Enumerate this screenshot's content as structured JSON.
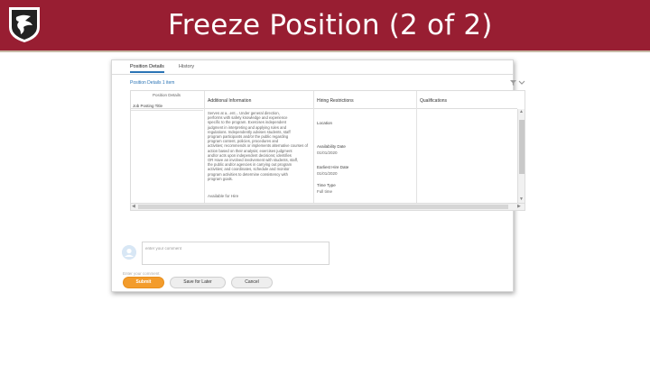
{
  "slide": {
    "title": "Freeze Position (2 of 2)",
    "colors": {
      "header": "#981e32",
      "accent": "#f39c2c",
      "link": "#2b74b5"
    }
  },
  "tabs": [
    {
      "label": "Position Details",
      "active": true
    },
    {
      "label": "History",
      "active": false
    }
  ],
  "grid": {
    "caption": "Position Details 1 item",
    "tools": [
      "filter-icon",
      "expand-icon"
    ],
    "headers": {
      "position_details": "Position Details",
      "additional_information": "Additional Information",
      "hiring_restrictions": "Hiring Restrictions",
      "qualifications": "Qualifications"
    },
    "row_label": "Job Posting Title",
    "description_lines": [
      "Serves at a...ent... Under general direction,",
      "performs with safety knowledge and experience",
      "specific to the program. Exercises independent",
      "judgment in interpreting and applying rules and",
      "regulations. Independently advises students, staff",
      "program participants and/or the public regarding",
      "program content, policies, procedures and",
      "activities; recommends or implements alternative courses of",
      "action based on their analysis; exercises judgment",
      "and/or acts upon independent decisions; identifies",
      "OR Have an involved involvement with students, staff,",
      "the public and/or agencies in carrying out program",
      "activities; and coordinates, schedule and monitor",
      "program activities to determine consistency with",
      "program goals."
    ],
    "available_for_hire": "Available for Hire",
    "hiring": [
      {
        "label": "Location",
        "value": ""
      },
      {
        "label": "Availability Date",
        "value": "01/01/2020"
      },
      {
        "label": "Earliest Hire Date",
        "value": "01/01/2020"
      },
      {
        "label": "Time Type",
        "value": "Full time"
      }
    ]
  },
  "comment": {
    "placeholder": "enter your comment",
    "hint": "Enter your comment"
  },
  "buttons": {
    "submit": "Submit",
    "save_for_later": "Save for Later",
    "cancel": "Cancel"
  }
}
